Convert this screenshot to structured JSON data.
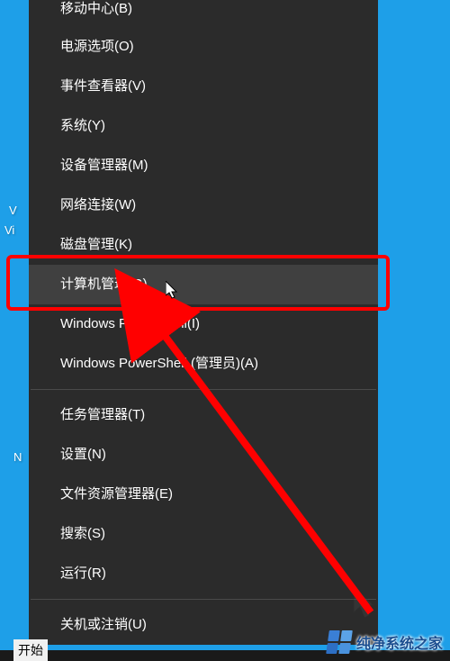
{
  "desktop": {
    "label1": "V",
    "label2": "Vi",
    "label3": "N"
  },
  "menu": {
    "items": [
      {
        "label": "移动中心(B)"
      },
      {
        "label": "电源选项(O)"
      },
      {
        "label": "事件查看器(V)"
      },
      {
        "label": "系统(Y)"
      },
      {
        "label": "设备管理器(M)"
      },
      {
        "label": "网络连接(W)"
      },
      {
        "label": "磁盘管理(K)"
      },
      {
        "label": "计算机管理(G)"
      },
      {
        "label": "Windows PowerShell(I)"
      },
      {
        "label": "Windows PowerShell (管理员)(A)"
      },
      {
        "label": "任务管理器(T)"
      },
      {
        "label": "设置(N)"
      },
      {
        "label": "文件资源管理器(E)"
      },
      {
        "label": "搜索(S)"
      },
      {
        "label": "运行(R)"
      },
      {
        "label": "关机或注销(U)"
      }
    ]
  },
  "taskbar": {
    "start": "开始"
  },
  "watermark": {
    "text": "纯净系统之家"
  }
}
